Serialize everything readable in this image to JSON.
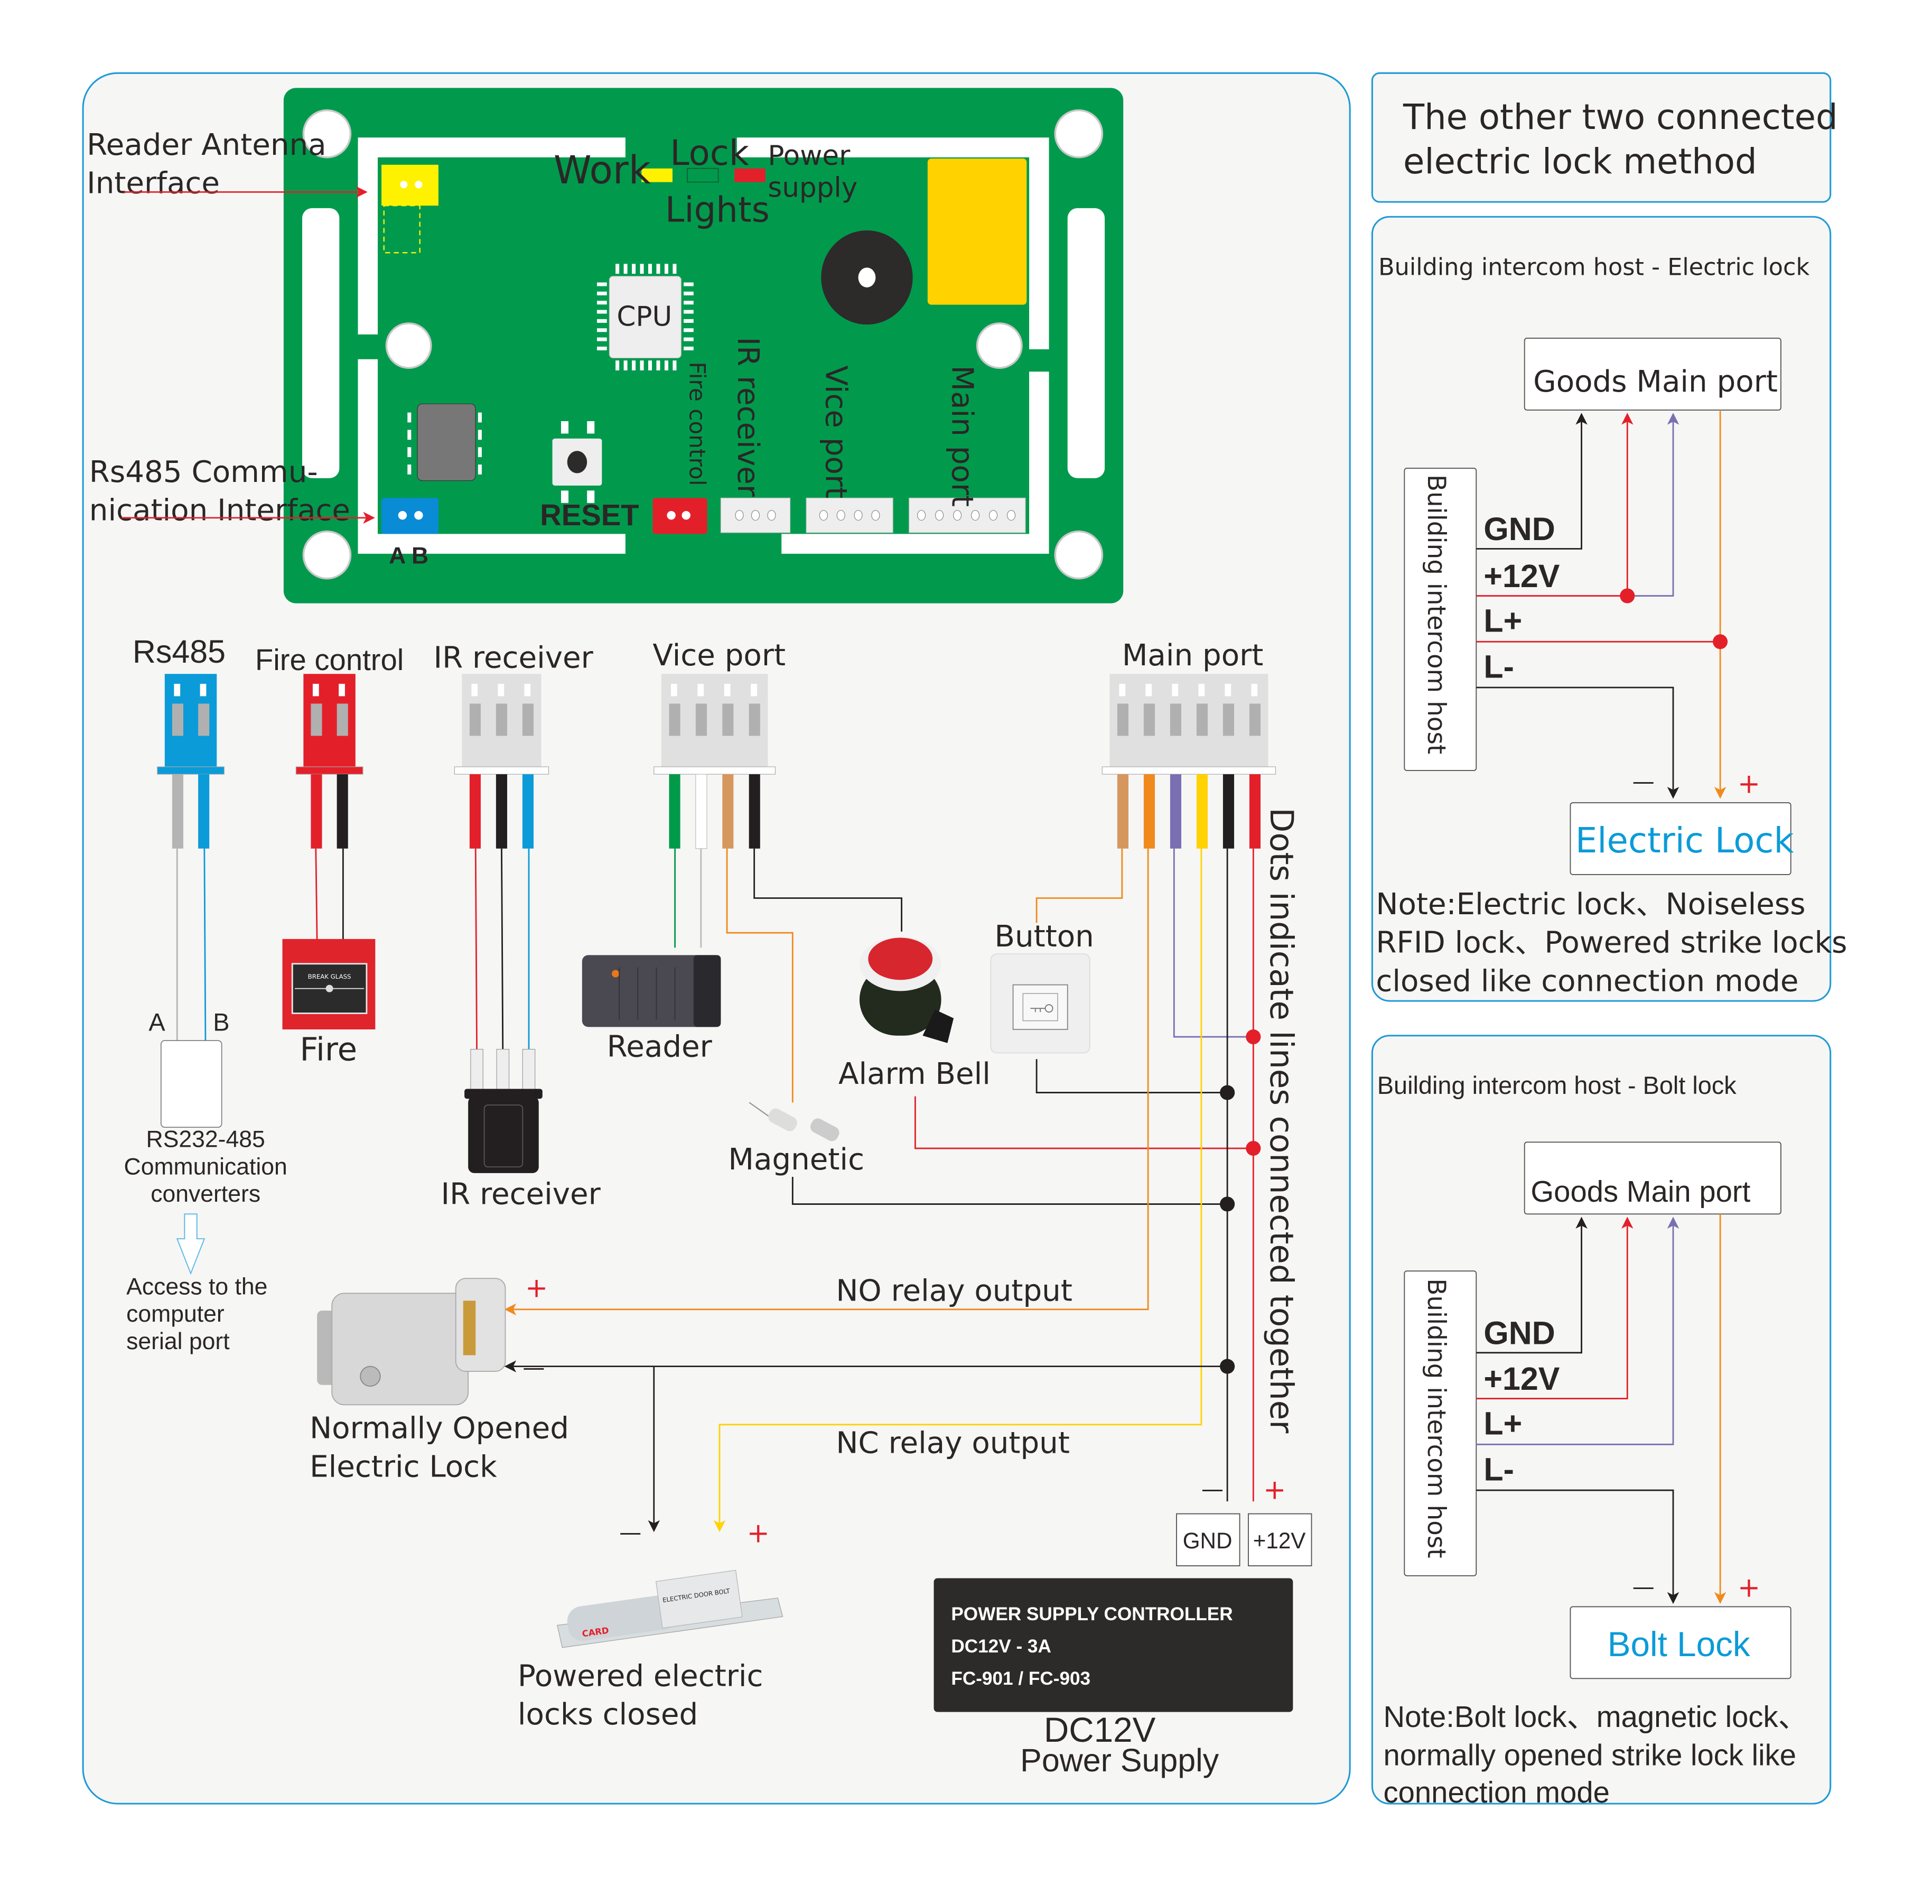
{
  "board": {
    "labels": {
      "reader_antenna": [
        "Reader Antenna",
        "Interface"
      ],
      "rs485_interface": [
        "Rs485 Commu-",
        "nication Interface"
      ],
      "work": "Work",
      "lock": "Lock",
      "power_supply": [
        "Power",
        "supply"
      ],
      "lights": "Lights",
      "cpu": "CPU",
      "reset": "RESET",
      "ab": "A B",
      "fire_control": "Fire control",
      "ir_receiver": "IR receiver",
      "vice_port": "Vice port",
      "main_port": "Main port"
    },
    "colors": {
      "pcb": "#019a4d",
      "rs485_header": "#0a8bd6",
      "fire_header": "#e3202a",
      "antenna_header": "#fff200",
      "relay": "#ffd200"
    }
  },
  "connectors": {
    "rs485": "Rs485",
    "fire_control": "Fire control",
    "ir_receiver": "IR receiver",
    "vice_port": "Vice port",
    "main_port": "Main port"
  },
  "devices": {
    "rs485_a": "A",
    "rs485_b": "B",
    "converter": [
      "RS232-485",
      "Communication",
      "converters"
    ],
    "computer": [
      "Access to the",
      "computer",
      "serial port"
    ],
    "fire": "Fire",
    "ir_receiver": "IR receiver",
    "reader": "Reader",
    "magnetic": "Magnetic",
    "alarm_bell": "Alarm Bell",
    "button": "Button",
    "no_lock": [
      "Normally Opened",
      "Electric Lock"
    ],
    "nc_lock": [
      "Powered electric",
      "locks closed"
    ],
    "fire_panel_text": [
      "BREAK GLASS"
    ]
  },
  "wiring": {
    "no_relay": "NO relay output",
    "nc_relay": "NC relay output",
    "dots_note": "Dots indicate lines connected together",
    "plus": "+",
    "minus": "—",
    "gnd_terminal": "GND",
    "v12_terminal": "+12V"
  },
  "power_supply": {
    "line1": "POWER SUPPLY CONTROLLER",
    "line2": "DC12V - 3A",
    "line3": "FC-901 / FC-903",
    "caption1": "DC12V",
    "caption2": "Power Supply"
  },
  "right": {
    "title": [
      "The other two connected",
      "electric lock method"
    ],
    "panel1": {
      "heading": "Building intercom host - Electric lock",
      "goods_port": "Goods  Main port",
      "host": "Building intercom host",
      "pins": [
        "GND",
        "+12V",
        "L+",
        "L-"
      ],
      "lock": "Electric Lock",
      "note": [
        "Note:Electric lock、Noiseless",
        "RFID lock、Powered strike locks",
        "closed like connection mode"
      ]
    },
    "panel2": {
      "heading": "Building intercom host - Bolt lock",
      "goods_port": "Goods   Main port",
      "host": "Building intercom host",
      "pins": [
        "GND",
        "+12V",
        "L+",
        "L-"
      ],
      "lock": "Bolt Lock",
      "note": [
        "Note:Bolt lock、magnetic lock、",
        "normally opened strike lock like",
        "connection mode"
      ]
    }
  },
  "wire_colors": {
    "red": "#e3202a",
    "black": "#231f20",
    "blue": "#0b9bd8",
    "gray": "#b4b4b4",
    "green": "#009a48",
    "white": "#ffffff",
    "tan": "#d6975e",
    "orange": "#f08a1d",
    "purple": "#7a6fb2",
    "yellow": "#ffd200"
  }
}
